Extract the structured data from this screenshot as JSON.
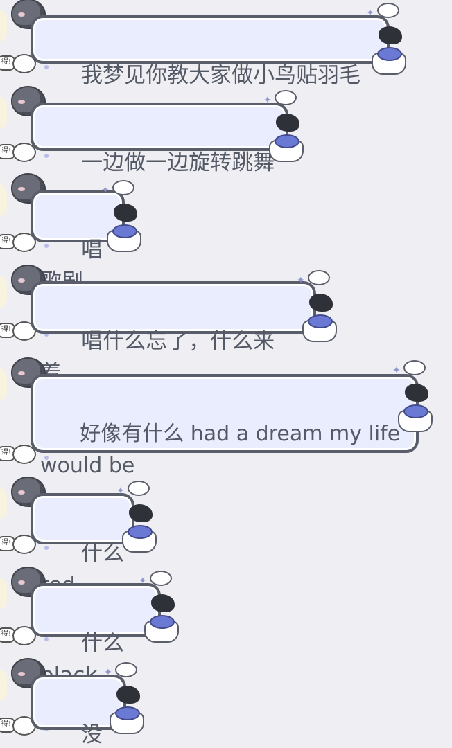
{
  "chat": {
    "messages": [
      {
        "text": "我梦见你教大家做小鸟贴羽毛"
      },
      {
        "text": "一边做一边旋转跳舞"
      },
      {
        "text": "唱歌剧"
      },
      {
        "text": "唱什么忘了，什么来着，"
      },
      {
        "text": "好像有什么 had a dream my life\nwould be"
      },
      {
        "text": "什么 red"
      },
      {
        "text": "什么 black"
      },
      {
        "text": "没记住！"
      }
    ],
    "left_sticker_tag": "得!"
  },
  "colors": {
    "background": "#efeff3",
    "bubble_fill": "#eaedfd",
    "bubble_border": "#5a5e6b",
    "text": "#545966"
  },
  "icons": {
    "avatar": "gray-cloud-avatar-icon",
    "sticker": "candy-sticker-icon",
    "deco_bird": "black-bird-icon",
    "deco_cake": "blueberry-cake-icon"
  }
}
